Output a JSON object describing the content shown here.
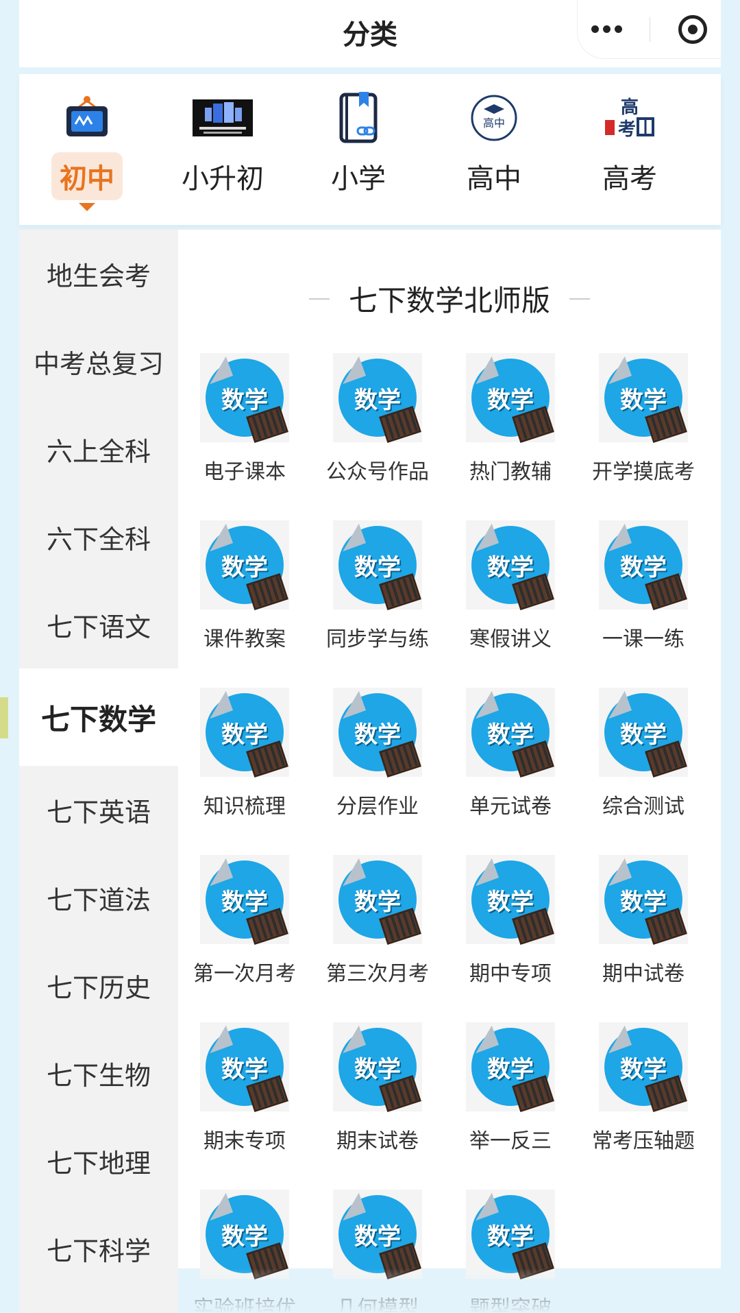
{
  "header": {
    "title": "分类",
    "more_icon": "more-dots-icon",
    "close_icon": "target-circle-icon"
  },
  "categories": [
    {
      "label": "初中",
      "active": true,
      "icon": "whiteboard-icon"
    },
    {
      "label": "小升初",
      "active": false,
      "icon": "promo-banner-icon"
    },
    {
      "label": "小学",
      "active": false,
      "icon": "book-link-icon"
    },
    {
      "label": "高中",
      "active": false,
      "icon": "graduation-cap-badge-icon"
    },
    {
      "label": "高考",
      "active": false,
      "icon": "gaokao-gate-icon"
    }
  ],
  "sidebar": {
    "items": [
      {
        "label": "地生会考"
      },
      {
        "label": "中考总复习"
      },
      {
        "label": "六上全科"
      },
      {
        "label": "六下全科"
      },
      {
        "label": "七下语文"
      },
      {
        "label": "七下数学",
        "active": true
      },
      {
        "label": "七下英语"
      },
      {
        "label": "七下道法"
      },
      {
        "label": "七下历史"
      },
      {
        "label": "七下生物"
      },
      {
        "label": "七下地理"
      },
      {
        "label": "七下科学"
      }
    ]
  },
  "main": {
    "section_title": "七下数学北师版",
    "icon_text": "数学",
    "items": [
      {
        "label": "电子课本"
      },
      {
        "label": "公众号作品"
      },
      {
        "label": "热门教辅"
      },
      {
        "label": "开学摸底考"
      },
      {
        "label": "课件教案"
      },
      {
        "label": "同步学与练"
      },
      {
        "label": "寒假讲义"
      },
      {
        "label": "一课一练"
      },
      {
        "label": "知识梳理"
      },
      {
        "label": "分层作业"
      },
      {
        "label": "单元试卷"
      },
      {
        "label": "综合测试"
      },
      {
        "label": "第一次月考"
      },
      {
        "label": "第三次月考"
      },
      {
        "label": "期中专项"
      },
      {
        "label": "期中试卷"
      },
      {
        "label": "期末专项"
      },
      {
        "label": "期末试卷"
      },
      {
        "label": "举一反三"
      },
      {
        "label": "常考压轴题"
      },
      {
        "label": "实验班培优"
      },
      {
        "label": "几何模型"
      },
      {
        "label": "题型突破"
      }
    ]
  },
  "colors": {
    "accent": "#e8741f",
    "accent_bg": "#fbe7da",
    "icon_blue": "#1ea6e6",
    "page_bg": "#e3f3fb"
  }
}
